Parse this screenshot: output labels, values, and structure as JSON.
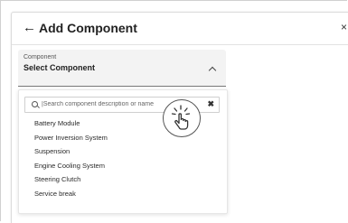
{
  "header": {
    "back_glyph": "←",
    "title": "Add Component",
    "close_glyph": "×"
  },
  "select": {
    "label": "Component",
    "value": "Select Component",
    "chevron_icon": "chevron-up-icon"
  },
  "search": {
    "placeholder": "|Search component description or name",
    "value": "",
    "clear_glyph": "✖"
  },
  "options": [
    "Battery Module",
    "Power Inversion System",
    "Suspension",
    "Engine Cooling System",
    "Steering Clutch",
    "Service break"
  ],
  "overlay": {
    "icon": "hand-pointer-icon"
  }
}
